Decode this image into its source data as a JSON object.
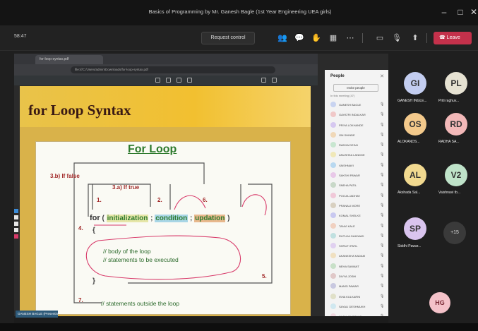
{
  "window": {
    "title": "Basics of Programming by Mr. Ganesh Bagle (1st Year Engineering UEA girls)",
    "minimize_glyph": "–",
    "maximize_glyph": "□",
    "close_glyph": "✕"
  },
  "meeting_bar": {
    "timer": "58:47",
    "request_control_label": "Request control",
    "leave_label": "Leave",
    "icons": [
      "people-icon",
      "chat-icon",
      "reactions-icon",
      "view-icon",
      "more-icon",
      "camera-icon",
      "mic-icon",
      "share-icon"
    ]
  },
  "shared_screen": {
    "browser_tab_title": "for-loop-syntax.pdf",
    "url": "file:///C:/Users/admin/Downloads/for-loop-syntax.pdf",
    "slide": {
      "title": "for Loop Syntax",
      "diagram_title": "For Loop",
      "label_false": "3.b) If false",
      "label_true": "3.a) If true",
      "step1": "1.",
      "step2": "2.",
      "step4": "4.",
      "step5": "5.",
      "step6": "6.",
      "step7": "7.",
      "code_for": "for",
      "code_open": " ( ",
      "code_init": "initialization",
      "code_sep1": " ; ",
      "code_cond": "condition",
      "code_sep2": " ; ",
      "code_update": "updation",
      "code_close": " )",
      "brace_open": "{",
      "brace_close": "}",
      "body_comment_1": "// body of the loop",
      "body_comment_2": "// statements to be executed",
      "outside_comment": "// statements outside the loop"
    },
    "status_label": "GANESH BAGLE (Presenting)"
  },
  "people_panel": {
    "title": "People",
    "invite_label": "Invite people",
    "subtitle": "In this meeting (47)",
    "participants": [
      {
        "name": "GANESH BAGLE",
        "color": "#c8d3f0"
      },
      {
        "name": "GAYATRI INDALKAR",
        "color": "#f0c8c8"
      },
      {
        "name": "PRIYA LOKHANDE",
        "color": "#d6c8f0"
      },
      {
        "name": "OM SHINDE",
        "color": "#f0d8b8"
      },
      {
        "name": "RADHA DESAI",
        "color": "#c8e6d0"
      },
      {
        "name": "ANUSHKA LANDGE",
        "color": "#f0e8b8"
      },
      {
        "name": "VAISHNAVI",
        "color": "#b8d8f0"
      },
      {
        "name": "SAKSHI PAWAR",
        "color": "#e8c8e8"
      },
      {
        "name": "SNEHA PATIL",
        "color": "#c8d8c8"
      },
      {
        "name": "POOJA JADHAV",
        "color": "#f0c8d8"
      },
      {
        "name": "PRANALI MORE",
        "color": "#d8d0c0"
      },
      {
        "name": "KOMAL SHELKE",
        "color": "#c8c8f0"
      },
      {
        "name": "TANVI KALE",
        "color": "#f0d0c0"
      },
      {
        "name": "RUTUJA GAIKWAD",
        "color": "#c0e0e0"
      },
      {
        "name": "SHRUTI PATIL",
        "color": "#e0d0f0"
      },
      {
        "name": "AKANKSHA KADAM",
        "color": "#f0e0c0"
      },
      {
        "name": "NEHA SAWANT",
        "color": "#c8e0c8"
      },
      {
        "name": "DIVYA JOSHI",
        "color": "#e0c8c8"
      },
      {
        "name": "MANSI PAWAR",
        "color": "#c8c8e0"
      },
      {
        "name": "ISHA KULKARNI",
        "color": "#e0e0c8"
      },
      {
        "name": "SAYALI DESHMUKH",
        "color": "#d0e8f0"
      },
      {
        "name": "KAJAL BHOSALE",
        "color": "#f0d8e0"
      }
    ]
  },
  "gallery": {
    "tiles": [
      {
        "initials": "GI",
        "name": "GANESH INGLE...",
        "color": "#c3cdf0"
      },
      {
        "initials": "PL",
        "name": "Priti raghuv...",
        "color": "#e6e2d2"
      },
      {
        "initials": "OS",
        "name": "ALOKANDS...",
        "color": "#f3c98b"
      },
      {
        "initials": "RD",
        "name": "RADHA SA...",
        "color": "#f2b8b8"
      },
      {
        "initials": "AL",
        "name": "Akshada Sal...",
        "color": "#f1d98f"
      },
      {
        "initials": "V2",
        "name": "Vaishnavi tb...",
        "color": "#bfe3c9"
      },
      {
        "initials": "SP",
        "name": "Siddhi Pawar...",
        "color": "#d9c4ee"
      }
    ],
    "overflow_label": "+15",
    "self_initials": "HG"
  }
}
